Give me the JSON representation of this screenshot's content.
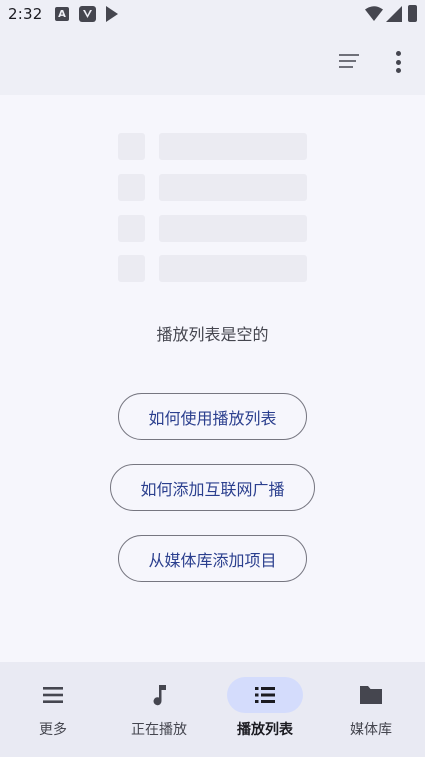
{
  "status_bar": {
    "time": "2:32",
    "icons": [
      "a-notification-icon",
      "v-notification-icon",
      "play-notification-icon",
      "wifi-icon",
      "signal-icon",
      "battery-icon"
    ]
  },
  "toolbar": {
    "actions": [
      "sort-icon",
      "more-vert-icon"
    ]
  },
  "empty_state": {
    "message": "播放列表是空的",
    "buttons": [
      {
        "label": "如何使用播放列表"
      },
      {
        "label": "如何添加互联网广播"
      },
      {
        "label": "从媒体库添加项目"
      }
    ]
  },
  "bottom_nav": {
    "items": [
      {
        "label": "更多",
        "icon": "menu-icon",
        "active": false
      },
      {
        "label": "正在播放",
        "icon": "music-note-icon",
        "active": false
      },
      {
        "label": "播放列表",
        "icon": "list-icon",
        "active": true
      },
      {
        "label": "媒体库",
        "icon": "folder-icon",
        "active": false
      }
    ]
  },
  "colors": {
    "background": "#f6f6fc",
    "top_bar": "#eeeff6",
    "accent_text": "#2b3f8e",
    "active_pill": "#d4dcfc",
    "icon": "#45464f"
  }
}
